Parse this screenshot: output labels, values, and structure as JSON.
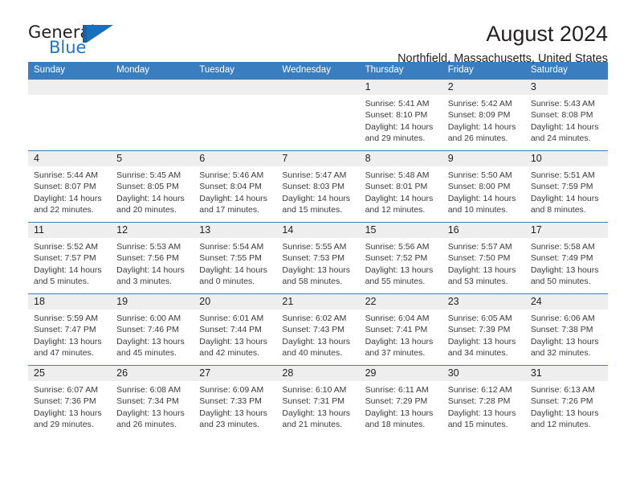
{
  "brand": {
    "name_first": "General",
    "name_second": "Blue",
    "mark": "triangle-logo",
    "colors": {
      "blue": "#2175c6",
      "dark": "#231f20",
      "header_blue": "#3a7ec0"
    }
  },
  "header": {
    "title": "August 2024",
    "subtitle": "Northfield, Massachusetts, United States"
  },
  "calendar": {
    "weekday_headers": [
      "Sunday",
      "Monday",
      "Tuesday",
      "Wednesday",
      "Thursday",
      "Friday",
      "Saturday"
    ],
    "weeks": [
      [
        {
          "date": "",
          "empty": true
        },
        {
          "date": "",
          "empty": true
        },
        {
          "date": "",
          "empty": true
        },
        {
          "date": "",
          "empty": true
        },
        {
          "date": "1",
          "sunrise": "Sunrise: 5:41 AM",
          "sunset": "Sunset: 8:10 PM",
          "daylight_line1": "Daylight: 14 hours",
          "daylight_line2": "and 29 minutes."
        },
        {
          "date": "2",
          "sunrise": "Sunrise: 5:42 AM",
          "sunset": "Sunset: 8:09 PM",
          "daylight_line1": "Daylight: 14 hours",
          "daylight_line2": "and 26 minutes."
        },
        {
          "date": "3",
          "sunrise": "Sunrise: 5:43 AM",
          "sunset": "Sunset: 8:08 PM",
          "daylight_line1": "Daylight: 14 hours",
          "daylight_line2": "and 24 minutes."
        }
      ],
      [
        {
          "date": "4",
          "sunrise": "Sunrise: 5:44 AM",
          "sunset": "Sunset: 8:07 PM",
          "daylight_line1": "Daylight: 14 hours",
          "daylight_line2": "and 22 minutes."
        },
        {
          "date": "5",
          "sunrise": "Sunrise: 5:45 AM",
          "sunset": "Sunset: 8:05 PM",
          "daylight_line1": "Daylight: 14 hours",
          "daylight_line2": "and 20 minutes."
        },
        {
          "date": "6",
          "sunrise": "Sunrise: 5:46 AM",
          "sunset": "Sunset: 8:04 PM",
          "daylight_line1": "Daylight: 14 hours",
          "daylight_line2": "and 17 minutes."
        },
        {
          "date": "7",
          "sunrise": "Sunrise: 5:47 AM",
          "sunset": "Sunset: 8:03 PM",
          "daylight_line1": "Daylight: 14 hours",
          "daylight_line2": "and 15 minutes."
        },
        {
          "date": "8",
          "sunrise": "Sunrise: 5:48 AM",
          "sunset": "Sunset: 8:01 PM",
          "daylight_line1": "Daylight: 14 hours",
          "daylight_line2": "and 12 minutes."
        },
        {
          "date": "9",
          "sunrise": "Sunrise: 5:50 AM",
          "sunset": "Sunset: 8:00 PM",
          "daylight_line1": "Daylight: 14 hours",
          "daylight_line2": "and 10 minutes."
        },
        {
          "date": "10",
          "sunrise": "Sunrise: 5:51 AM",
          "sunset": "Sunset: 7:59 PM",
          "daylight_line1": "Daylight: 14 hours",
          "daylight_line2": "and 8 minutes."
        }
      ],
      [
        {
          "date": "11",
          "sunrise": "Sunrise: 5:52 AM",
          "sunset": "Sunset: 7:57 PM",
          "daylight_line1": "Daylight: 14 hours",
          "daylight_line2": "and 5 minutes."
        },
        {
          "date": "12",
          "sunrise": "Sunrise: 5:53 AM",
          "sunset": "Sunset: 7:56 PM",
          "daylight_line1": "Daylight: 14 hours",
          "daylight_line2": "and 3 minutes."
        },
        {
          "date": "13",
          "sunrise": "Sunrise: 5:54 AM",
          "sunset": "Sunset: 7:55 PM",
          "daylight_line1": "Daylight: 14 hours",
          "daylight_line2": "and 0 minutes."
        },
        {
          "date": "14",
          "sunrise": "Sunrise: 5:55 AM",
          "sunset": "Sunset: 7:53 PM",
          "daylight_line1": "Daylight: 13 hours",
          "daylight_line2": "and 58 minutes."
        },
        {
          "date": "15",
          "sunrise": "Sunrise: 5:56 AM",
          "sunset": "Sunset: 7:52 PM",
          "daylight_line1": "Daylight: 13 hours",
          "daylight_line2": "and 55 minutes."
        },
        {
          "date": "16",
          "sunrise": "Sunrise: 5:57 AM",
          "sunset": "Sunset: 7:50 PM",
          "daylight_line1": "Daylight: 13 hours",
          "daylight_line2": "and 53 minutes."
        },
        {
          "date": "17",
          "sunrise": "Sunrise: 5:58 AM",
          "sunset": "Sunset: 7:49 PM",
          "daylight_line1": "Daylight: 13 hours",
          "daylight_line2": "and 50 minutes."
        }
      ],
      [
        {
          "date": "18",
          "sunrise": "Sunrise: 5:59 AM",
          "sunset": "Sunset: 7:47 PM",
          "daylight_line1": "Daylight: 13 hours",
          "daylight_line2": "and 47 minutes."
        },
        {
          "date": "19",
          "sunrise": "Sunrise: 6:00 AM",
          "sunset": "Sunset: 7:46 PM",
          "daylight_line1": "Daylight: 13 hours",
          "daylight_line2": "and 45 minutes."
        },
        {
          "date": "20",
          "sunrise": "Sunrise: 6:01 AM",
          "sunset": "Sunset: 7:44 PM",
          "daylight_line1": "Daylight: 13 hours",
          "daylight_line2": "and 42 minutes."
        },
        {
          "date": "21",
          "sunrise": "Sunrise: 6:02 AM",
          "sunset": "Sunset: 7:43 PM",
          "daylight_line1": "Daylight: 13 hours",
          "daylight_line2": "and 40 minutes."
        },
        {
          "date": "22",
          "sunrise": "Sunrise: 6:04 AM",
          "sunset": "Sunset: 7:41 PM",
          "daylight_line1": "Daylight: 13 hours",
          "daylight_line2": "and 37 minutes."
        },
        {
          "date": "23",
          "sunrise": "Sunrise: 6:05 AM",
          "sunset": "Sunset: 7:39 PM",
          "daylight_line1": "Daylight: 13 hours",
          "daylight_line2": "and 34 minutes."
        },
        {
          "date": "24",
          "sunrise": "Sunrise: 6:06 AM",
          "sunset": "Sunset: 7:38 PM",
          "daylight_line1": "Daylight: 13 hours",
          "daylight_line2": "and 32 minutes."
        }
      ],
      [
        {
          "date": "25",
          "sunrise": "Sunrise: 6:07 AM",
          "sunset": "Sunset: 7:36 PM",
          "daylight_line1": "Daylight: 13 hours",
          "daylight_line2": "and 29 minutes."
        },
        {
          "date": "26",
          "sunrise": "Sunrise: 6:08 AM",
          "sunset": "Sunset: 7:34 PM",
          "daylight_line1": "Daylight: 13 hours",
          "daylight_line2": "and 26 minutes."
        },
        {
          "date": "27",
          "sunrise": "Sunrise: 6:09 AM",
          "sunset": "Sunset: 7:33 PM",
          "daylight_line1": "Daylight: 13 hours",
          "daylight_line2": "and 23 minutes."
        },
        {
          "date": "28",
          "sunrise": "Sunrise: 6:10 AM",
          "sunset": "Sunset: 7:31 PM",
          "daylight_line1": "Daylight: 13 hours",
          "daylight_line2": "and 21 minutes."
        },
        {
          "date": "29",
          "sunrise": "Sunrise: 6:11 AM",
          "sunset": "Sunset: 7:29 PM",
          "daylight_line1": "Daylight: 13 hours",
          "daylight_line2": "and 18 minutes."
        },
        {
          "date": "30",
          "sunrise": "Sunrise: 6:12 AM",
          "sunset": "Sunset: 7:28 PM",
          "daylight_line1": "Daylight: 13 hours",
          "daylight_line2": "and 15 minutes."
        },
        {
          "date": "31",
          "sunrise": "Sunrise: 6:13 AM",
          "sunset": "Sunset: 7:26 PM",
          "daylight_line1": "Daylight: 13 hours",
          "daylight_line2": "and 12 minutes."
        }
      ]
    ]
  }
}
